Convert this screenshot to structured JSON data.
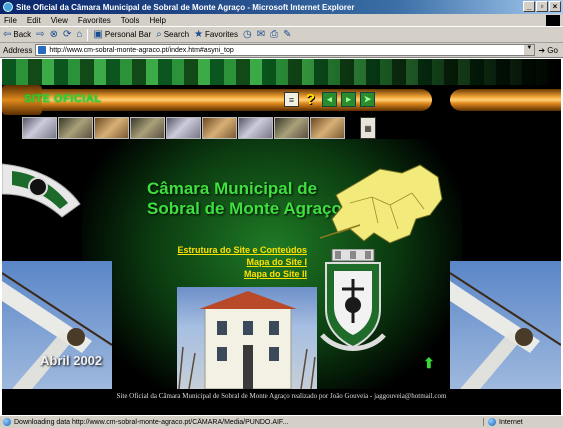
{
  "window": {
    "title": "Site Oficial da Câmara Municipal de Sobral de Monte Agraço - Microsoft Internet Explorer",
    "controls": [
      "_",
      "▫",
      "×"
    ]
  },
  "menu": [
    "File",
    "Edit",
    "View",
    "Favorites",
    "Tools",
    "Help"
  ],
  "toolbar": {
    "back_label": "Back",
    "personal_bar_label": "Personal Bar",
    "search_label": "Search",
    "favorites_label": "Favorites"
  },
  "address": {
    "label": "Address",
    "url": "http://www.cm-sobral-monte-agraco.pt/index.htm#asyni_top",
    "go_label": "Go"
  },
  "page": {
    "site_tag": "SITE OFICIAL",
    "title_line1": "Câmara Municipal de",
    "title_line2": "Sobral de Monte Agraço",
    "links": [
      "Estrutura do Site e Conteúdos",
      "Mapa do Site I",
      "Mapa do Site II"
    ],
    "date": "Abril 2002",
    "footer": "Site Oficial da Câmara Municipal de Sobral de Monte Agraço realizado por João Gouveia - jaggouveia@hotmail.com"
  },
  "status": {
    "text": "Downloading data http://www.cm-sobral-monte-agraco.pt/CÂMARA/Media/PUNDO.AIF...",
    "zone": "Internet"
  },
  "colors": {
    "title_green": "#3ee03e",
    "link_yellow": "#ffe100",
    "pipe_orange": "#f0a233",
    "background": "#000000"
  }
}
